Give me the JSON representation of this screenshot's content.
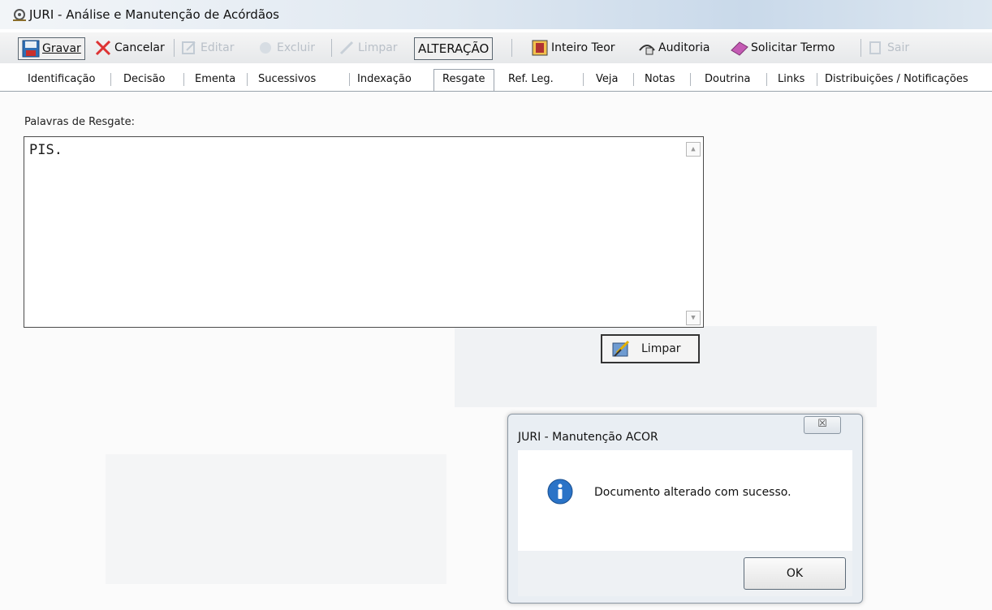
{
  "window": {
    "title": "JURI - Análise e Manutenção de Acórdãos",
    "icon": "app-gear-icon"
  },
  "toolbar": {
    "gravar": "Gravar",
    "cancelar": "Cancelar",
    "editar": "Editar",
    "excluir": "Excluir",
    "limpar": "Limpar",
    "mode": "ALTERAÇÃO",
    "inteiro_teor": "Inteiro Teor",
    "auditoria": "Auditoria",
    "solicitar_termo": "Solicitar Termo",
    "sair": "Sair"
  },
  "tabs": [
    "Identificação",
    "Decisão",
    "Ementa",
    "Sucessivos",
    "Indexação",
    "Resgate",
    "Ref. Leg.",
    "Veja",
    "Notas",
    "Doutrina",
    "Links",
    "Distribuições / Notificações"
  ],
  "active_tab": "Resgate",
  "resgate": {
    "label": "Palavras de Resgate:",
    "value": "PIS.",
    "clear_button": "Limpar"
  },
  "dialog": {
    "title": "JURI - Manutenção ACOR",
    "message": "Documento alterado com sucesso.",
    "ok": "OK",
    "close_glyph": "☒"
  }
}
